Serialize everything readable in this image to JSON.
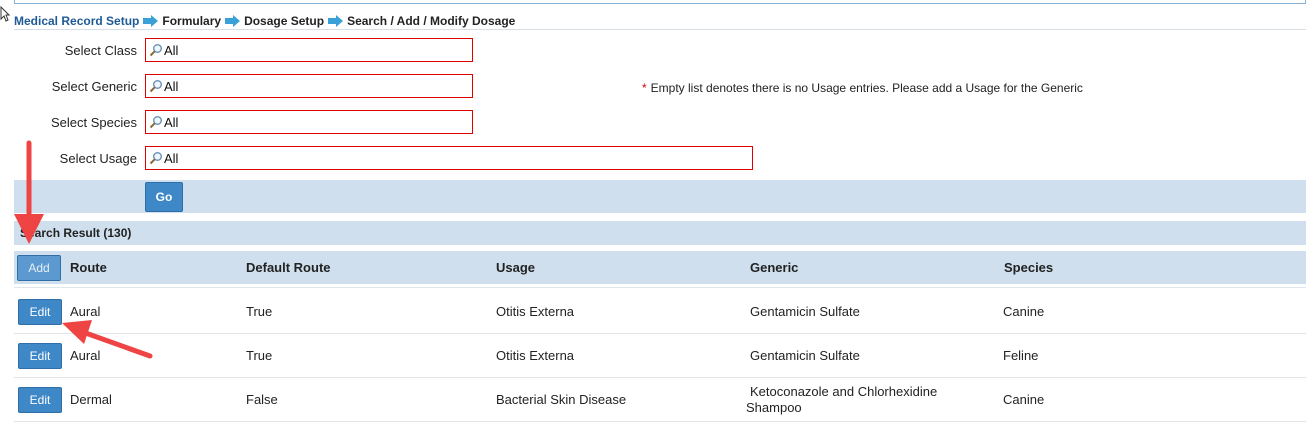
{
  "breadcrumb": {
    "items": [
      "Medical Record Setup",
      "Formulary",
      "Dosage Setup",
      "Search / Add / Modify Dosage"
    ]
  },
  "filters": {
    "class_label": "Select Class",
    "class_value": "All",
    "generic_label": "Select Generic",
    "generic_value": "All",
    "species_label": "Select Species",
    "species_value": "All",
    "usage_label": "Select Usage",
    "usage_value": "All",
    "note_star": "*",
    "note_text": "Empty list denotes there is no Usage entries. Please add a Usage for the Generic",
    "go_label": "Go"
  },
  "results": {
    "title": "Search Result (130)",
    "add_label": "Add",
    "edit_label": "Edit",
    "columns": [
      "Route",
      "Default Route",
      "Usage",
      "Generic",
      "Species"
    ],
    "rows": [
      {
        "route": "Aural",
        "default_route": "True",
        "usage": "Otitis Externa",
        "generic_line1": "Gentamicin Sulfate",
        "generic_line2": "",
        "species": "Canine"
      },
      {
        "route": "Aural",
        "default_route": "True",
        "usage": "Otitis Externa",
        "generic_line1": "Gentamicin Sulfate",
        "generic_line2": "",
        "species": "Feline"
      },
      {
        "route": "Dermal",
        "default_route": "False",
        "usage": "Bacterial Skin Disease",
        "generic_line1": "Ketoconazole and Chlorhexidine",
        "generic_line2": "Shampoo",
        "species": "Canine"
      }
    ]
  },
  "colors": {
    "accent": "#3f88c7",
    "band": "#cfdfed",
    "field_border": "#e00000",
    "annotation_arrow": "#ee4444"
  },
  "icons": [
    "magnifier-icon",
    "breadcrumb-arrow-icon",
    "cursor-icon"
  ]
}
